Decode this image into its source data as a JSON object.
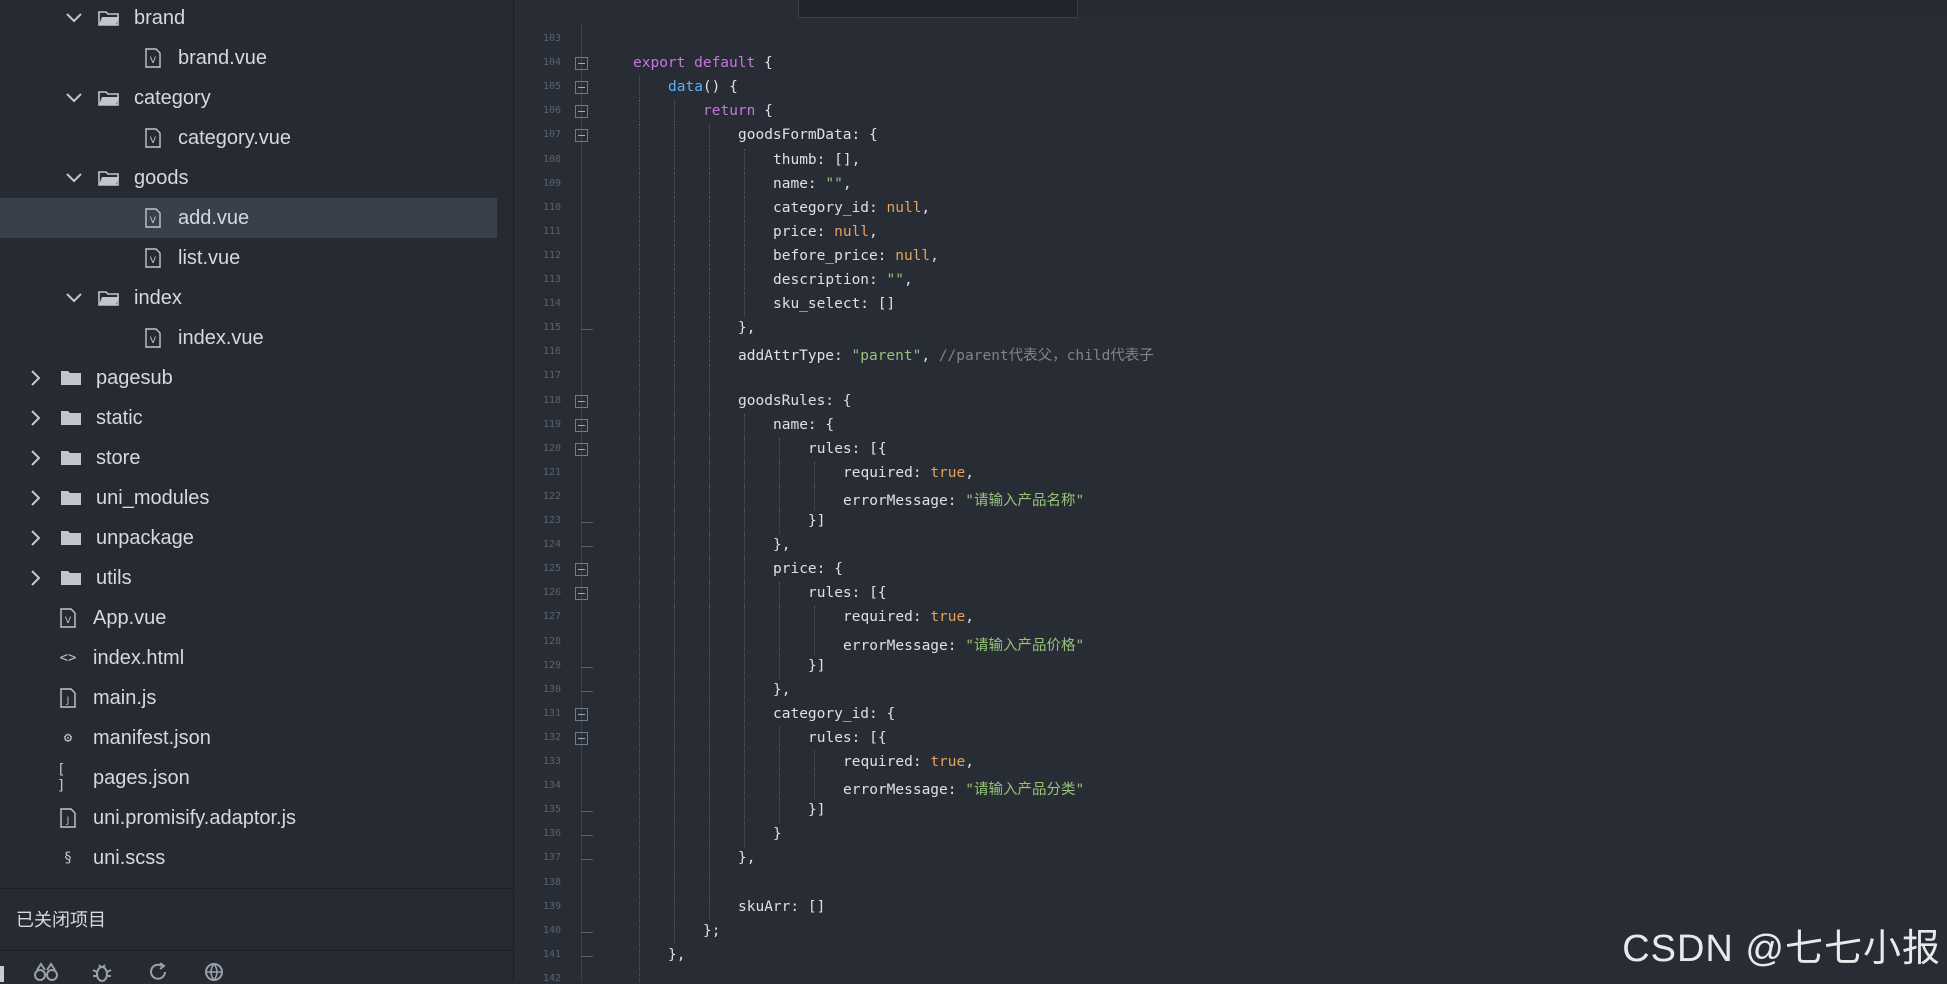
{
  "sidebar": {
    "tree": [
      {
        "label": "brand",
        "type": "folder",
        "level": 1,
        "expanded": true,
        "icon": "folder-open-icon"
      },
      {
        "label": "brand.vue",
        "type": "file",
        "level": 2,
        "icon": "vue-file-icon",
        "glyph": "V"
      },
      {
        "label": "category",
        "type": "folder",
        "level": 1,
        "expanded": true,
        "icon": "folder-open-icon"
      },
      {
        "label": "category.vue",
        "type": "file",
        "level": 2,
        "icon": "vue-file-icon",
        "glyph": "V"
      },
      {
        "label": "goods",
        "type": "folder",
        "level": 1,
        "expanded": true,
        "icon": "folder-open-icon"
      },
      {
        "label": "add.vue",
        "type": "file",
        "level": 2,
        "icon": "vue-file-icon",
        "glyph": "V",
        "selected": true
      },
      {
        "label": "list.vue",
        "type": "file",
        "level": 2,
        "icon": "vue-file-icon",
        "glyph": "V"
      },
      {
        "label": "index",
        "type": "folder",
        "level": 1,
        "expanded": true,
        "icon": "folder-open-icon"
      },
      {
        "label": "index.vue",
        "type": "file",
        "level": 2,
        "icon": "vue-file-icon",
        "glyph": "V"
      },
      {
        "label": "pagesub",
        "type": "folder",
        "level": 0,
        "expanded": false,
        "icon": "folder-icon"
      },
      {
        "label": "static",
        "type": "folder",
        "level": 0,
        "expanded": false,
        "icon": "folder-icon"
      },
      {
        "label": "store",
        "type": "folder",
        "level": 0,
        "expanded": false,
        "icon": "folder-icon"
      },
      {
        "label": "uni_modules",
        "type": "folder",
        "level": 0,
        "expanded": false,
        "icon": "folder-icon"
      },
      {
        "label": "unpackage",
        "type": "folder",
        "level": 0,
        "expanded": false,
        "icon": "folder-icon"
      },
      {
        "label": "utils",
        "type": "folder",
        "level": 0,
        "expanded": false,
        "icon": "folder-icon"
      },
      {
        "label": "App.vue",
        "type": "file",
        "level": 0,
        "icon": "vue-file-icon",
        "glyph": "V"
      },
      {
        "label": "index.html",
        "type": "file",
        "level": 0,
        "icon": "html-file-icon",
        "glyph": "<>"
      },
      {
        "label": "main.js",
        "type": "file",
        "level": 0,
        "icon": "js-file-icon",
        "glyph": "J"
      },
      {
        "label": "manifest.json",
        "type": "file",
        "level": 0,
        "icon": "manifest-file-icon",
        "glyph": "⚙"
      },
      {
        "label": "pages.json",
        "type": "file",
        "level": 0,
        "icon": "json-file-icon",
        "glyph": "[ ]"
      },
      {
        "label": "uni.promisify.adaptor.js",
        "type": "file",
        "level": 0,
        "icon": "js-file-icon",
        "glyph": "J"
      },
      {
        "label": "uni.scss",
        "type": "file",
        "level": 0,
        "icon": "scss-file-icon",
        "glyph": "§"
      }
    ],
    "closed_projects_label": "已关闭项目",
    "toolbar": [
      {
        "name": "binoculars-icon",
        "glyph": "⌕"
      },
      {
        "name": "bug-icon",
        "glyph": "✲"
      },
      {
        "name": "refresh-icon",
        "glyph": "↻"
      },
      {
        "name": "globe-icon",
        "glyph": "◍"
      }
    ]
  },
  "editor": {
    "lines": [
      {
        "n": "103",
        "indent": 0,
        "fold": "",
        "code": []
      },
      {
        "n": "104",
        "indent": 0,
        "fold": "open",
        "code": [
          [
            "kw",
            "export default"
          ],
          [
            "pun",
            " {"
          ]
        ]
      },
      {
        "n": "105",
        "indent": 1,
        "fold": "open",
        "code": [
          [
            "fn",
            "data"
          ],
          [
            "pun",
            "() {"
          ]
        ]
      },
      {
        "n": "106",
        "indent": 2,
        "fold": "open",
        "code": [
          [
            "kw",
            "return"
          ],
          [
            "pun",
            " {"
          ]
        ]
      },
      {
        "n": "107",
        "indent": 3,
        "fold": "open",
        "code": [
          [
            "pun",
            "goodsFormData: {"
          ]
        ]
      },
      {
        "n": "108",
        "indent": 4,
        "fold": "",
        "code": [
          [
            "pun",
            "thumb: [],"
          ]
        ]
      },
      {
        "n": "109",
        "indent": 4,
        "fold": "",
        "code": [
          [
            "pun",
            "name: "
          ],
          [
            "str",
            "\"\""
          ],
          [
            "pun",
            ","
          ]
        ]
      },
      {
        "n": "110",
        "indent": 4,
        "fold": "",
        "code": [
          [
            "pun",
            "category_id: "
          ],
          [
            "lit",
            "null"
          ],
          [
            "pun",
            ","
          ]
        ]
      },
      {
        "n": "111",
        "indent": 4,
        "fold": "",
        "code": [
          [
            "pun",
            "price: "
          ],
          [
            "lit",
            "null"
          ],
          [
            "pun",
            ","
          ]
        ]
      },
      {
        "n": "112",
        "indent": 4,
        "fold": "",
        "code": [
          [
            "pun",
            "before_price: "
          ],
          [
            "lit",
            "null"
          ],
          [
            "pun",
            ","
          ]
        ]
      },
      {
        "n": "113",
        "indent": 4,
        "fold": "",
        "code": [
          [
            "pun",
            "description: "
          ],
          [
            "str",
            "\"\""
          ],
          [
            "pun",
            ","
          ]
        ]
      },
      {
        "n": "114",
        "indent": 4,
        "fold": "",
        "code": [
          [
            "pun",
            "sku_select: []"
          ]
        ]
      },
      {
        "n": "115",
        "indent": 3,
        "fold": "end",
        "code": [
          [
            "pun",
            "},"
          ]
        ]
      },
      {
        "n": "116",
        "indent": 3,
        "fold": "",
        "code": [
          [
            "pun",
            "addAttrType: "
          ],
          [
            "str",
            "\"parent\""
          ],
          [
            "pun",
            ", "
          ],
          [
            "cmt",
            "//parent代表父，child代表子"
          ]
        ]
      },
      {
        "n": "117",
        "indent": 3,
        "fold": "",
        "code": []
      },
      {
        "n": "118",
        "indent": 3,
        "fold": "open",
        "code": [
          [
            "pun",
            "goodsRules: {"
          ]
        ]
      },
      {
        "n": "119",
        "indent": 4,
        "fold": "open",
        "code": [
          [
            "pun",
            "name: {"
          ]
        ]
      },
      {
        "n": "120",
        "indent": 5,
        "fold": "open",
        "code": [
          [
            "pun",
            "rules: [{"
          ]
        ]
      },
      {
        "n": "121",
        "indent": 6,
        "fold": "",
        "code": [
          [
            "pun",
            "required: "
          ],
          [
            "lit",
            "true"
          ],
          [
            "pun",
            ","
          ]
        ]
      },
      {
        "n": "122",
        "indent": 6,
        "fold": "",
        "code": [
          [
            "pun",
            "errorMessage: "
          ],
          [
            "str",
            "\"请输入产品名称\""
          ]
        ]
      },
      {
        "n": "123",
        "indent": 5,
        "fold": "end",
        "code": [
          [
            "pun",
            "}]"
          ]
        ]
      },
      {
        "n": "124",
        "indent": 4,
        "fold": "end",
        "code": [
          [
            "pun",
            "},"
          ]
        ]
      },
      {
        "n": "125",
        "indent": 4,
        "fold": "open",
        "code": [
          [
            "pun",
            "price: {"
          ]
        ]
      },
      {
        "n": "126",
        "indent": 5,
        "fold": "open",
        "code": [
          [
            "pun",
            "rules: [{"
          ]
        ]
      },
      {
        "n": "127",
        "indent": 6,
        "fold": "",
        "code": [
          [
            "pun",
            "required: "
          ],
          [
            "lit",
            "true"
          ],
          [
            "pun",
            ","
          ]
        ]
      },
      {
        "n": "128",
        "indent": 6,
        "fold": "",
        "code": [
          [
            "pun",
            "errorMessage: "
          ],
          [
            "str",
            "\"请输入产品价格\""
          ]
        ]
      },
      {
        "n": "129",
        "indent": 5,
        "fold": "end",
        "code": [
          [
            "pun",
            "}]"
          ]
        ]
      },
      {
        "n": "130",
        "indent": 4,
        "fold": "end",
        "code": [
          [
            "pun",
            "},"
          ]
        ]
      },
      {
        "n": "131",
        "indent": 4,
        "fold": "open",
        "code": [
          [
            "pun",
            "category_id: {"
          ]
        ]
      },
      {
        "n": "132",
        "indent": 5,
        "fold": "open",
        "code": [
          [
            "pun",
            "rules: [{"
          ]
        ]
      },
      {
        "n": "133",
        "indent": 6,
        "fold": "",
        "code": [
          [
            "pun",
            "required: "
          ],
          [
            "lit",
            "true"
          ],
          [
            "pun",
            ","
          ]
        ]
      },
      {
        "n": "134",
        "indent": 6,
        "fold": "",
        "code": [
          [
            "pun",
            "errorMessage: "
          ],
          [
            "str",
            "\"请输入产品分类\""
          ]
        ]
      },
      {
        "n": "135",
        "indent": 5,
        "fold": "end",
        "code": [
          [
            "pun",
            "}]"
          ]
        ]
      },
      {
        "n": "136",
        "indent": 4,
        "fold": "end",
        "code": [
          [
            "pun",
            "}"
          ]
        ]
      },
      {
        "n": "137",
        "indent": 3,
        "fold": "end",
        "code": [
          [
            "pun",
            "},"
          ]
        ]
      },
      {
        "n": "138",
        "indent": 3,
        "fold": "",
        "code": []
      },
      {
        "n": "139",
        "indent": 3,
        "fold": "",
        "code": [
          [
            "pun",
            "skuArr: []"
          ]
        ]
      },
      {
        "n": "140",
        "indent": 2,
        "fold": "end",
        "code": [
          [
            "pun",
            "};"
          ]
        ]
      },
      {
        "n": "141",
        "indent": 1,
        "fold": "end",
        "code": [
          [
            "pun",
            "},"
          ]
        ]
      },
      {
        "n": "142",
        "indent": 1,
        "fold": "",
        "code": []
      }
    ],
    "colors": {
      "keyword": "#c678dd",
      "function": "#61afef",
      "string": "#98c379",
      "literal": "#e5a35f",
      "comment": "#7f848e",
      "text": "#dde1e6"
    }
  },
  "watermark": "CSDN @七七小报"
}
